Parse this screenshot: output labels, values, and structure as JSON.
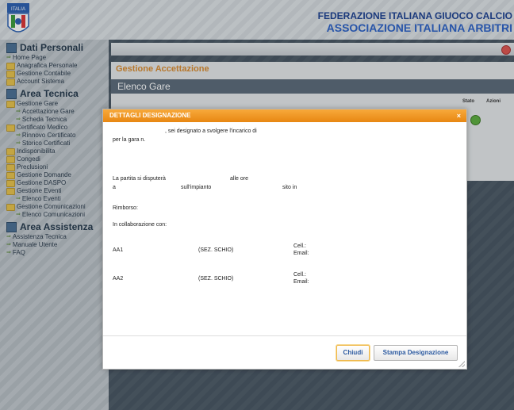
{
  "header": {
    "logo_text": "ITALIA",
    "org_line1": "FEDERAZIONE ITALIANA GIUOCO CALCIO",
    "org_line2": "ASSOCIAZIONE ITALIANA ARBITRI"
  },
  "sidebar": {
    "sections": [
      {
        "title": "Dati Personali",
        "items": [
          {
            "label": "Home Page",
            "icon": "arrow",
            "sub": false
          },
          {
            "label": "Anagrafica Personale",
            "icon": "folder",
            "sub": false
          },
          {
            "label": "Gestione Contabile",
            "icon": "folder",
            "sub": false
          },
          {
            "label": "Account Sistema",
            "icon": "folder",
            "sub": false
          }
        ]
      },
      {
        "title": "Area Tecnica",
        "items": [
          {
            "label": "Gestione Gare",
            "icon": "folder",
            "sub": false
          },
          {
            "label": "Accettazione Gare",
            "icon": "arrow",
            "sub": true
          },
          {
            "label": "Scheda Tecnica",
            "icon": "arrow",
            "sub": true
          },
          {
            "label": "Certificato Medico",
            "icon": "folder",
            "sub": false
          },
          {
            "label": "Rinnovo Certificato",
            "icon": "arrow",
            "sub": true
          },
          {
            "label": "Storico Certificati",
            "icon": "arrow",
            "sub": true
          },
          {
            "label": "Indisponibilita",
            "icon": "folder",
            "sub": false
          },
          {
            "label": "Congedi",
            "icon": "folder",
            "sub": false
          },
          {
            "label": "Preclusioni",
            "icon": "folder",
            "sub": false
          },
          {
            "label": "Gestione Domande",
            "icon": "folder",
            "sub": false
          },
          {
            "label": "Gestione DASPO",
            "icon": "folder",
            "sub": false
          },
          {
            "label": "Gestione Eventi",
            "icon": "folder",
            "sub": false
          },
          {
            "label": "Elenco Eventi",
            "icon": "arrow",
            "sub": true
          },
          {
            "label": "Gestione Comunicazioni",
            "icon": "folder",
            "sub": false
          },
          {
            "label": "Elenco Comunicazioni",
            "icon": "arrow",
            "sub": true
          }
        ]
      },
      {
        "title": "Area Assistenza",
        "items": [
          {
            "label": "Assistenza Tecnica",
            "icon": "arrow",
            "sub": false
          },
          {
            "label": "Manuale Utente",
            "icon": "arrow",
            "sub": false
          },
          {
            "label": "FAQ",
            "icon": "arrow",
            "sub": false
          }
        ]
      }
    ]
  },
  "main": {
    "panel_title": "Gestione Accettazione",
    "list_title": "Elenco Gare",
    "col_stato": "Stato",
    "col_azioni": "Azioni"
  },
  "dialog": {
    "title": "DETTAGLI DESIGNAZIONE",
    "close": "×",
    "line_designato": ", sei designato a svolgere l'incarico di",
    "line_gara": "per la gara n.",
    "line_partita": "La partita si disputerà",
    "line_ore": "alle ore",
    "line_a": "a",
    "line_impianto": "sull'impianto",
    "line_sito": "sito in",
    "rimborso": "Rimborso:",
    "collab": "In collaborazione con:",
    "assistants": [
      {
        "role": "AA1",
        "section": "(SEZ. SCHIO)",
        "cell": "Cell.:",
        "email": "Email:"
      },
      {
        "role": "AA2",
        "section": "(SEZ. SCHIO)",
        "cell": "Cell.:",
        "email": "Email:"
      }
    ],
    "btn_close": "Chiudi",
    "btn_print": "Stampa Designazione"
  },
  "colors": {
    "accent": "#e88712",
    "brand": "#1a3f8f"
  }
}
